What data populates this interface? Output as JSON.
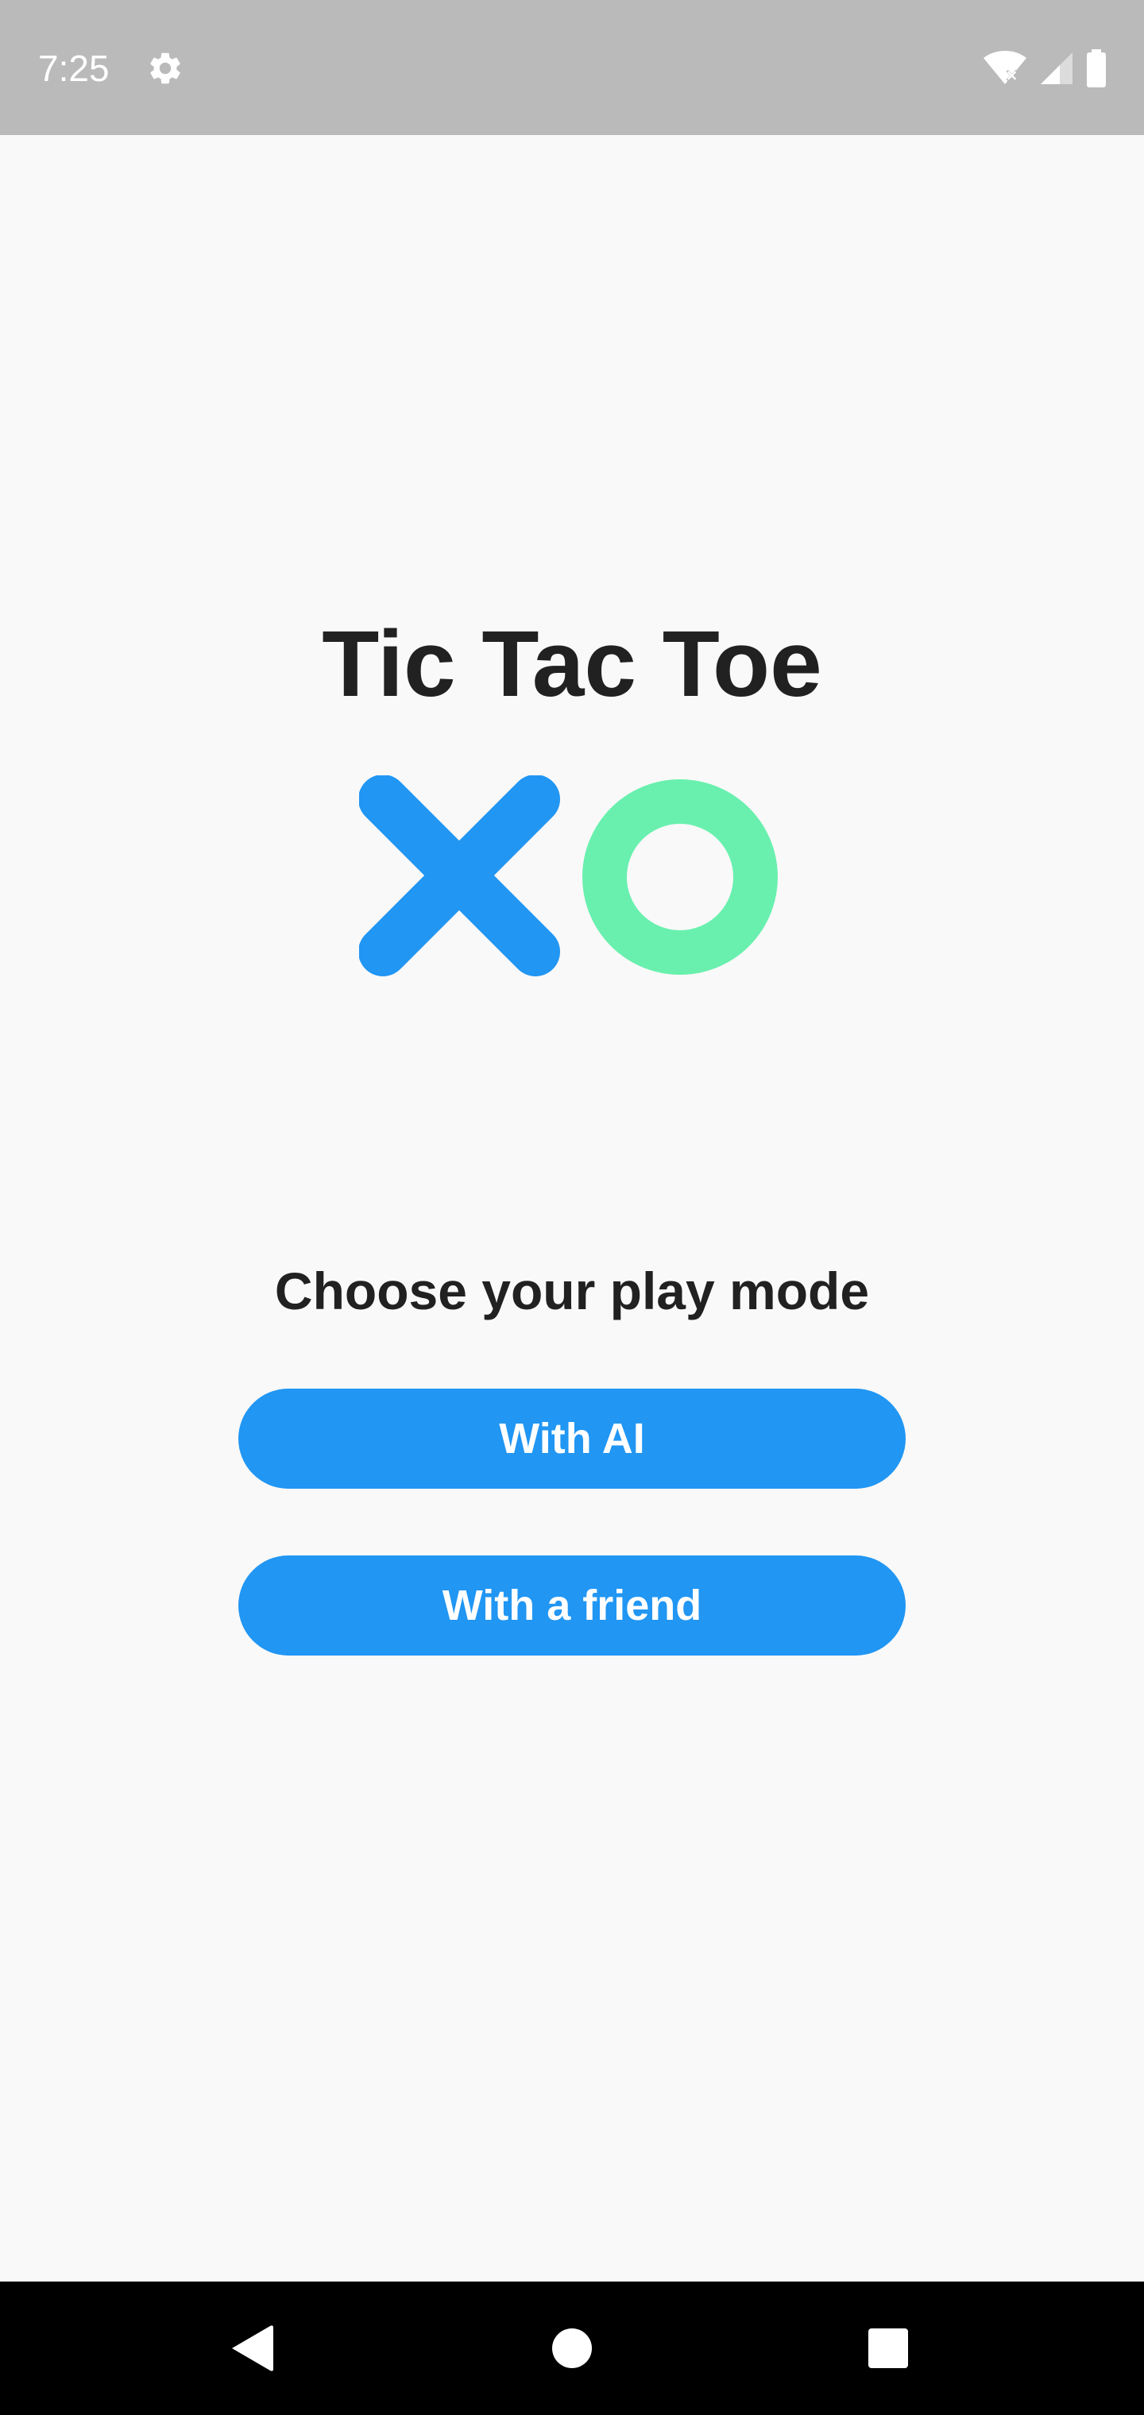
{
  "status_bar": {
    "time": "7:25",
    "icons": [
      "gear-icon",
      "wifi-off-icon",
      "cell-signal-icon",
      "battery-icon"
    ]
  },
  "app": {
    "title": "Tic Tac Toe",
    "logo": {
      "x_color": "#2196f3",
      "o_color": "#69f0ae"
    },
    "subtitle": "Choose your play mode",
    "buttons": {
      "with_ai": "With AI",
      "with_friend": "With a friend"
    },
    "accent_color": "#2196f3"
  },
  "nav_bar": {
    "icons": [
      "back-icon",
      "home-icon",
      "recents-icon"
    ]
  }
}
